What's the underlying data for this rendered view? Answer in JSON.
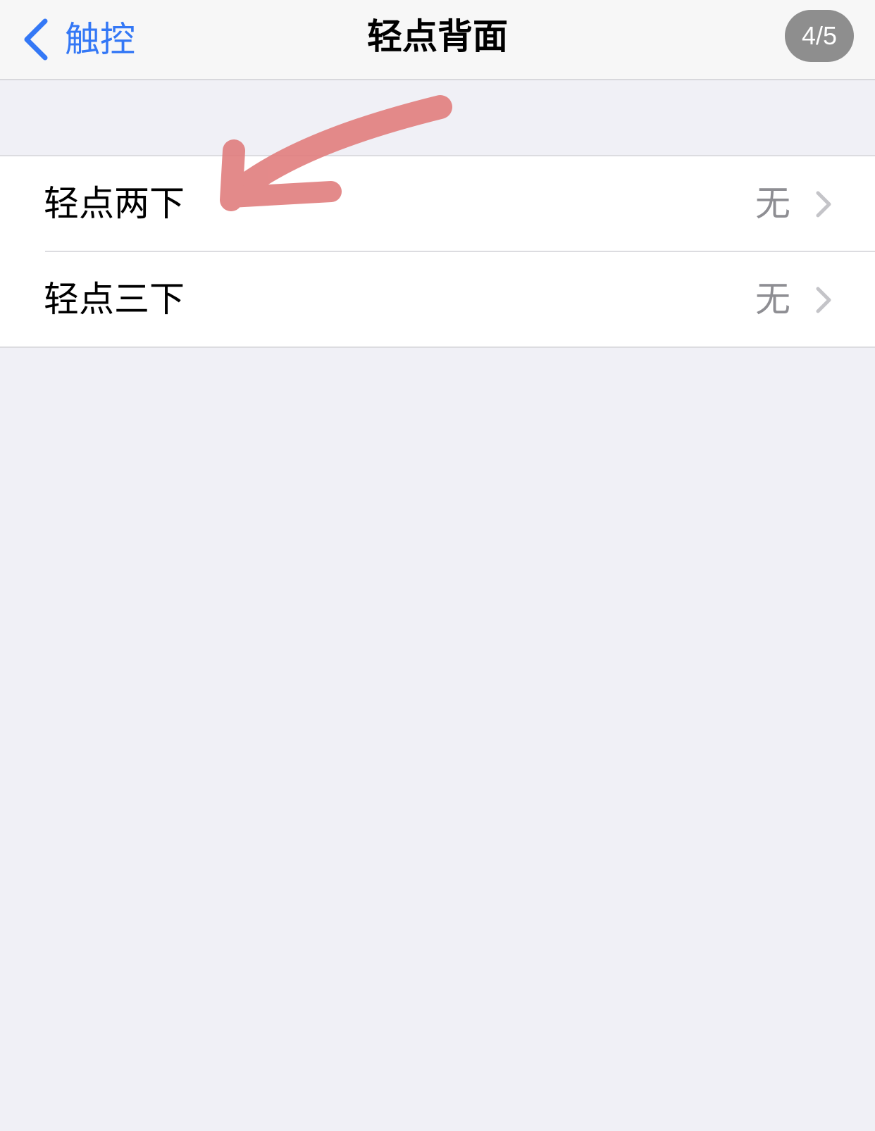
{
  "nav": {
    "back_label": "触控",
    "title": "轻点背面",
    "page_indicator": "4/5"
  },
  "rows": [
    {
      "label": "轻点两下",
      "value": "无"
    },
    {
      "label": "轻点三下",
      "value": "无"
    }
  ],
  "colors": {
    "accent": "#3478f6",
    "background": "#f0f0f6",
    "annotation": "#e07a7a"
  },
  "icons": {
    "back": "chevron-left-icon",
    "disclosure": "chevron-right-icon",
    "annotation": "arrow-annotation-icon"
  }
}
